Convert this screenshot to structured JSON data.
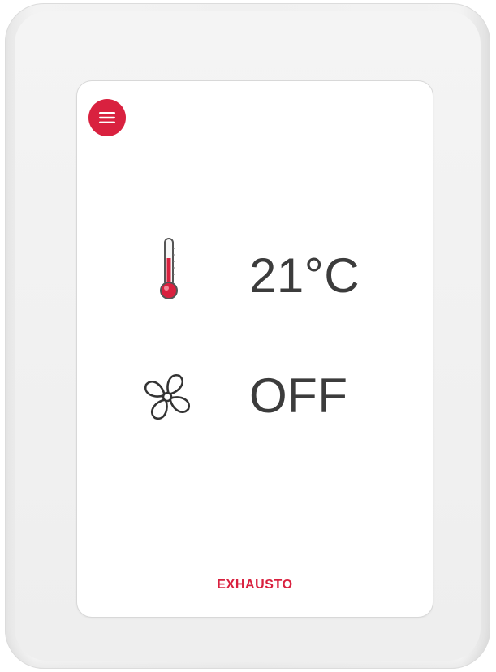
{
  "device": {
    "brand": "EXHAUSTO"
  },
  "menu": {
    "icon": "hamburger-menu-icon"
  },
  "temperature": {
    "icon": "thermometer-icon",
    "value": "21°C"
  },
  "fan": {
    "icon": "fan-icon",
    "status": "OFF"
  },
  "colors": {
    "accent": "#d9213f",
    "text": "#3c3c3c",
    "screen": "#ffffff",
    "housing": "#f0f0f0"
  }
}
